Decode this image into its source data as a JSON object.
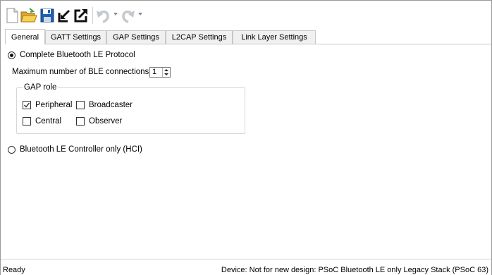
{
  "toolbar": {
    "icons": [
      "new-document-icon",
      "open-folder-icon",
      "save-icon",
      "import-icon",
      "export-icon",
      "undo-icon",
      "redo-icon"
    ]
  },
  "tabs": [
    {
      "label": "General",
      "active": true
    },
    {
      "label": "GATT Settings",
      "active": false
    },
    {
      "label": "GAP Settings",
      "active": false
    },
    {
      "label": "L2CAP Settings",
      "active": false
    },
    {
      "label": "Link Layer Settings",
      "active": false
    }
  ],
  "general": {
    "complete_protocol_label": "Complete Bluetooth LE Protocol",
    "complete_protocol_selected": true,
    "max_connections_label": "Maximum number of BLE connections:",
    "max_connections_value": "1",
    "gap_role": {
      "title": "GAP role",
      "peripheral": {
        "label": "Peripheral",
        "checked": true
      },
      "broadcaster": {
        "label": "Broadcaster",
        "checked": false
      },
      "central": {
        "label": "Central",
        "checked": false
      },
      "observer": {
        "label": "Observer",
        "checked": false
      }
    },
    "controller_only_label": "Bluetooth LE Controller only (HCI)",
    "controller_only_selected": false
  },
  "status": {
    "left": "Ready",
    "right": "Device: Not for new design: PSoC Bluetooth LE only Legacy Stack (PSoC 63)"
  }
}
